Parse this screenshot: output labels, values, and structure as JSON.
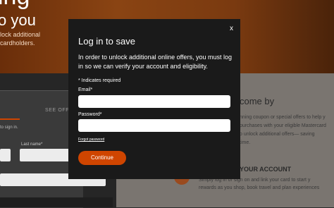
{
  "background": {
    "hero_line1": "ing",
    "hero_line2": "o you",
    "hero_sub1": "lock additional",
    "hero_sub2": "cardholders.",
    "tab_label": "SEE OFF",
    "signin_text": "to sign in.",
    "last_name_label": "Last name*",
    "right_heading": "come by",
    "right_body": [
      "nning coupon or special offers to help y",
      "purchases with your eligible Mastercard",
      "o unlock additional offers— saving",
      "time."
    ],
    "account_heading": "YOUR ACCOUNT",
    "account_body": [
      "Simply log in or sign on and link your card to start y",
      "rewards as you shop, book travel and plan experiences"
    ]
  },
  "modal": {
    "close_label": "x",
    "title": "Log in to save",
    "description_lines": [
      "In order to unlock additional online offers, you must log",
      "in so we can verify your account and eligibility."
    ],
    "required_note": "* Indicates required",
    "email_label": "Email*",
    "email_value": "",
    "password_label": "Password*",
    "password_value": "",
    "forgot_password": "Forgot password",
    "continue_label": "Continue"
  },
  "colors": {
    "accent": "#cf4500",
    "modal_bg": "#1a1a1a",
    "hero_orange": "#8a4413"
  }
}
